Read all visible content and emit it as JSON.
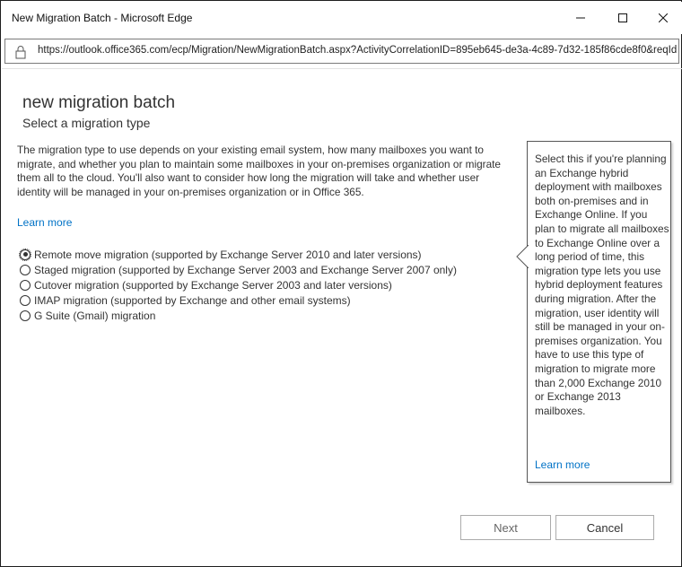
{
  "window": {
    "title": "New Migration Batch - Microsoft Edge",
    "minimize_glyph": "–",
    "maximize_glyph": "☐",
    "close_glyph": "✕"
  },
  "address_bar": {
    "url": "https://outlook.office365.com/ecp/Migration/NewMigrationBatch.aspx?ActivityCorrelationID=895eb645-de3a-4c89-7d32-185f86cde8f0&reqId"
  },
  "page": {
    "title": "new migration batch",
    "subtitle": "Select a migration type",
    "intro": "The migration type to use depends on your existing email system, how many mailboxes you want to migrate, and whether you plan to maintain some mailboxes in your on-premises organization or migrate them all to the cloud. You'll also want to consider how long the migration will take and whether user identity will be managed in your on-premises organization or in Office 365.",
    "learn_more": "Learn more"
  },
  "migration_types": [
    {
      "label": "Remote move migration (supported by Exchange Server 2010 and later versions)",
      "selected": true
    },
    {
      "label": "Staged migration (supported by Exchange Server 2003 and Exchange Server 2007 only)",
      "selected": false
    },
    {
      "label": "Cutover migration (supported by Exchange Server 2003 and later versions)",
      "selected": false
    },
    {
      "label": "IMAP migration (supported by Exchange and other email systems)",
      "selected": false
    },
    {
      "label": "G Suite (Gmail) migration",
      "selected": false
    }
  ],
  "callout": {
    "text": "Select this if you're planning an Exchange hybrid deployment with mailboxes both on-premises and in Exchange Online. If you plan to migrate all mailboxes to Exchange Online over a long period of time, this migration type lets you use hybrid deployment features during migration. After the migration, user identity will still be managed in your on-premises organization. You have to use this type of migration to migrate more than 2,000 Exchange 2010 or Exchange 2013 mailboxes.",
    "learn_more": "Learn more"
  },
  "buttons": {
    "next": "Next",
    "cancel": "Cancel"
  },
  "colors": {
    "link": "#0072c6",
    "text": "#333333",
    "border": "#ababab"
  }
}
